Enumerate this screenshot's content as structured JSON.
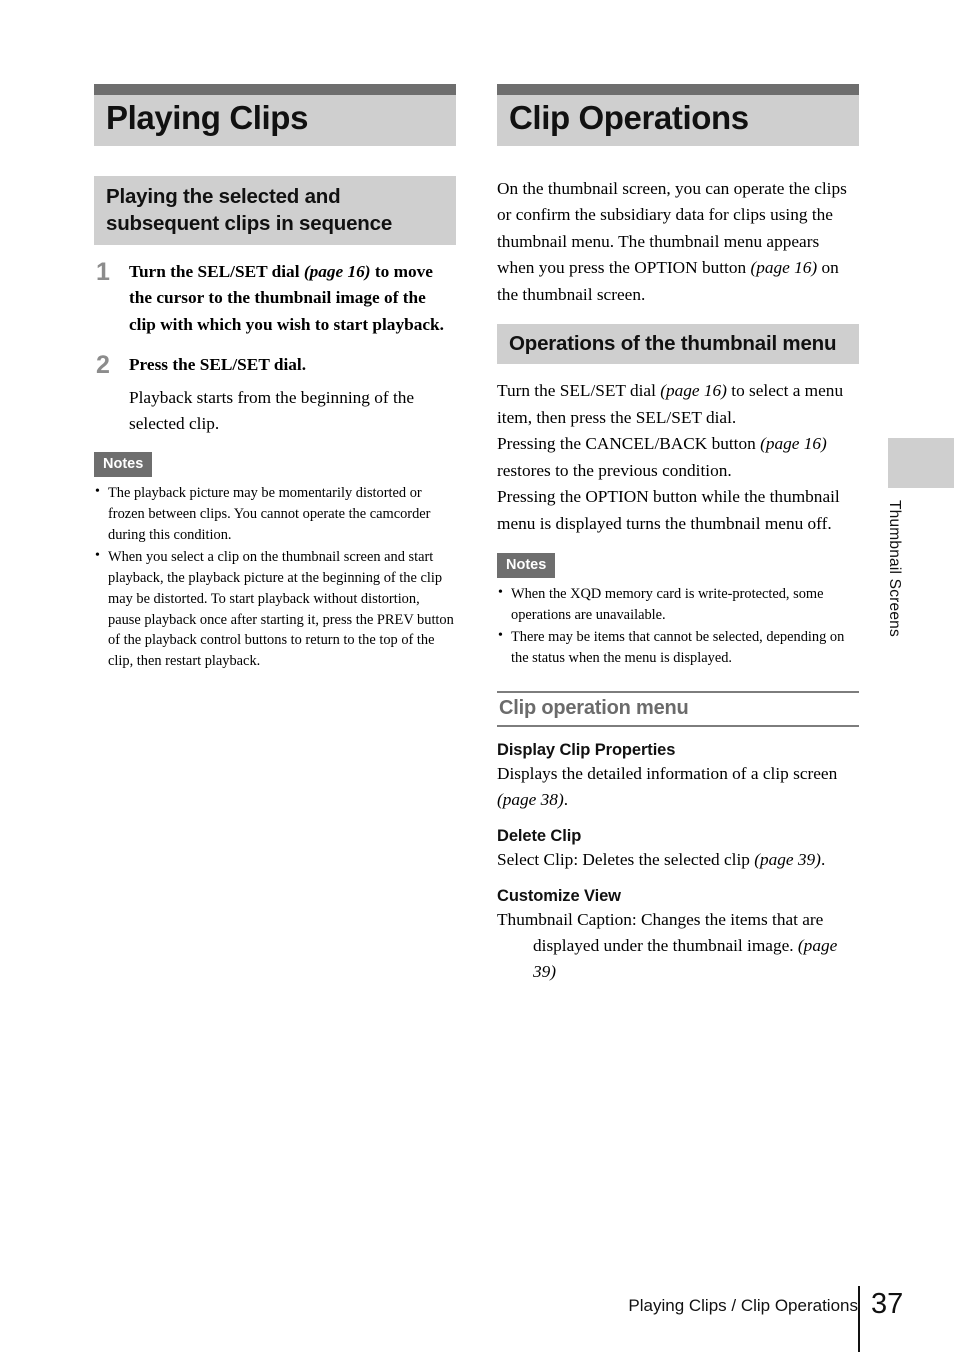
{
  "left_column": {
    "chapter_title": "Playing Clips",
    "section_title": "Playing the selected and subsequent clips in sequence",
    "steps": [
      {
        "number": "1",
        "title_before": "Turn the SEL/SET dial ",
        "title_ref": "(page 16)",
        "title_after": " to move the cursor to the thumbnail image of the clip with which you wish to start playback.",
        "sub": ""
      },
      {
        "number": "2",
        "title_before": "Press the SEL/SET dial.",
        "title_ref": "",
        "title_after": "",
        "sub": "Playback starts from the beginning of the selected clip."
      }
    ],
    "notes_label": "Notes",
    "notes": [
      "The playback picture may be momentarily distorted or frozen between clips. You cannot operate the camcorder during this condition.",
      "When you select a clip on the thumbnail screen and start playback, the playback picture at the beginning of the clip may be distorted. To start playback without distortion, pause playback once after starting it, press the PREV button of the playback control buttons to return to the top of the clip, then restart playback."
    ]
  },
  "right_column": {
    "chapter_title": "Clip Operations",
    "intro_before": "On the thumbnail screen, you can operate the clips or confirm the subsidiary data for clips using the thumbnail menu. The thumbnail menu appears when you press the OPTION button ",
    "intro_ref": "(page 16)",
    "intro_after": " on the thumbnail screen.",
    "section_title": "Operations of the thumbnail menu",
    "paragraphs": [
      {
        "before": "Turn the SEL/SET dial ",
        "ref": "(page 16)",
        "after": " to select a menu item, then press the SEL/SET dial."
      },
      {
        "before": "Pressing the CANCEL/BACK button ",
        "ref": "(page 16)",
        "after": " restores to the previous condition."
      },
      {
        "before": "Pressing the OPTION button while the thumbnail menu is displayed turns the thumbnail menu off.",
        "ref": "",
        "after": ""
      }
    ],
    "notes_label": "Notes",
    "notes": [
      "When the XQD memory card is write-protected, some operations are unavailable.",
      "There may be items that cannot be selected, depending on the status when the menu is displayed."
    ],
    "menu_heading": "Clip operation menu",
    "menu_entries": [
      {
        "title": "Display Clip Properties",
        "desc_before": "Displays the detailed information of a clip screen ",
        "desc_ref": "(page 38)",
        "desc_after": ".",
        "hang": false
      },
      {
        "title": "Delete Clip",
        "desc_before": "Select Clip: Deletes the selected clip ",
        "desc_ref": "(page 39)",
        "desc_after": ".",
        "hang": false
      },
      {
        "title": "Customize View",
        "desc_before": "Thumbnail Caption: Changes the items that are displayed under the thumbnail image. ",
        "desc_ref": "(page 39)",
        "desc_after": "",
        "hang": true
      }
    ]
  },
  "side_tab": {
    "label": "Thumbnail Screens"
  },
  "footer": {
    "text": "Playing Clips / Clip Operations",
    "page_number": "37"
  },
  "colors": {
    "header_bar_dark": "#6e6e6e",
    "header_bg_light": "#cfcfcf",
    "step_number": "#8c8c8c",
    "rule_heading": "#6b6b6b"
  }
}
